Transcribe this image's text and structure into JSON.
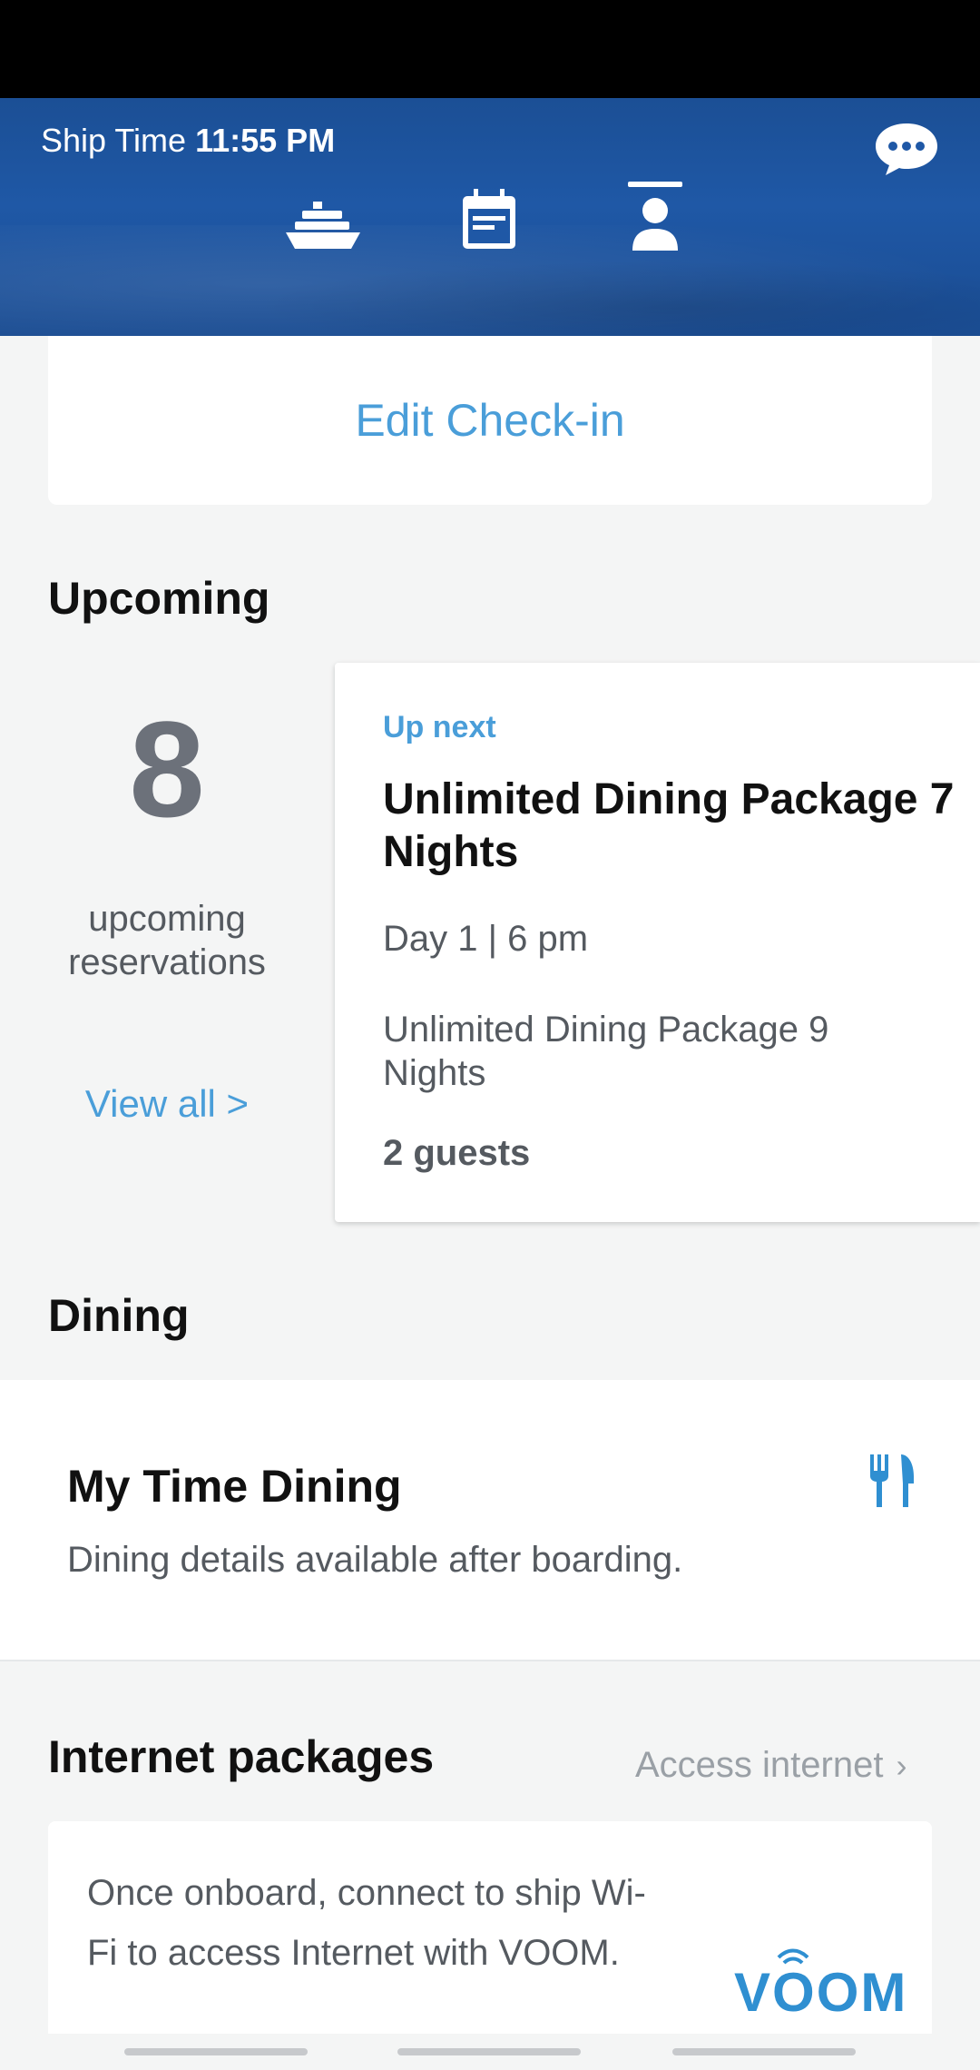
{
  "header": {
    "ship_time_label": "Ship Time",
    "ship_time_value": "11:55 PM",
    "chat_icon": "chat-bubble-icon",
    "tabs": [
      {
        "icon": "ship-icon",
        "active": false
      },
      {
        "icon": "calendar-icon",
        "active": false
      },
      {
        "icon": "person-icon",
        "active": true
      }
    ]
  },
  "checkin": {
    "label": "Edit Check-in"
  },
  "upcoming": {
    "title": "Upcoming",
    "count": "8",
    "count_label": "upcoming reservations",
    "view_all": "View all >",
    "next": {
      "tag": "Up next",
      "title": "Unlimited Dining Package 7 Nights",
      "time": "Day 1 | 6 pm",
      "description": "Unlimited Dining Package 9 Nights",
      "guests": "2 guests"
    }
  },
  "dining": {
    "title": "Dining",
    "card_title": "My Time Dining",
    "card_subtitle": "Dining details available after boarding.",
    "icon": "fork-knife-icon"
  },
  "internet": {
    "title": "Internet packages",
    "access_link": "Access internet",
    "text": "Once onboard, connect to ship Wi-Fi to access Internet with VOOM.",
    "logo": "VOOM"
  },
  "colors": {
    "accent": "#4a9ed9",
    "header_blue": "#1f58a6",
    "text_dark": "#111111",
    "text_muted": "#555a60"
  }
}
